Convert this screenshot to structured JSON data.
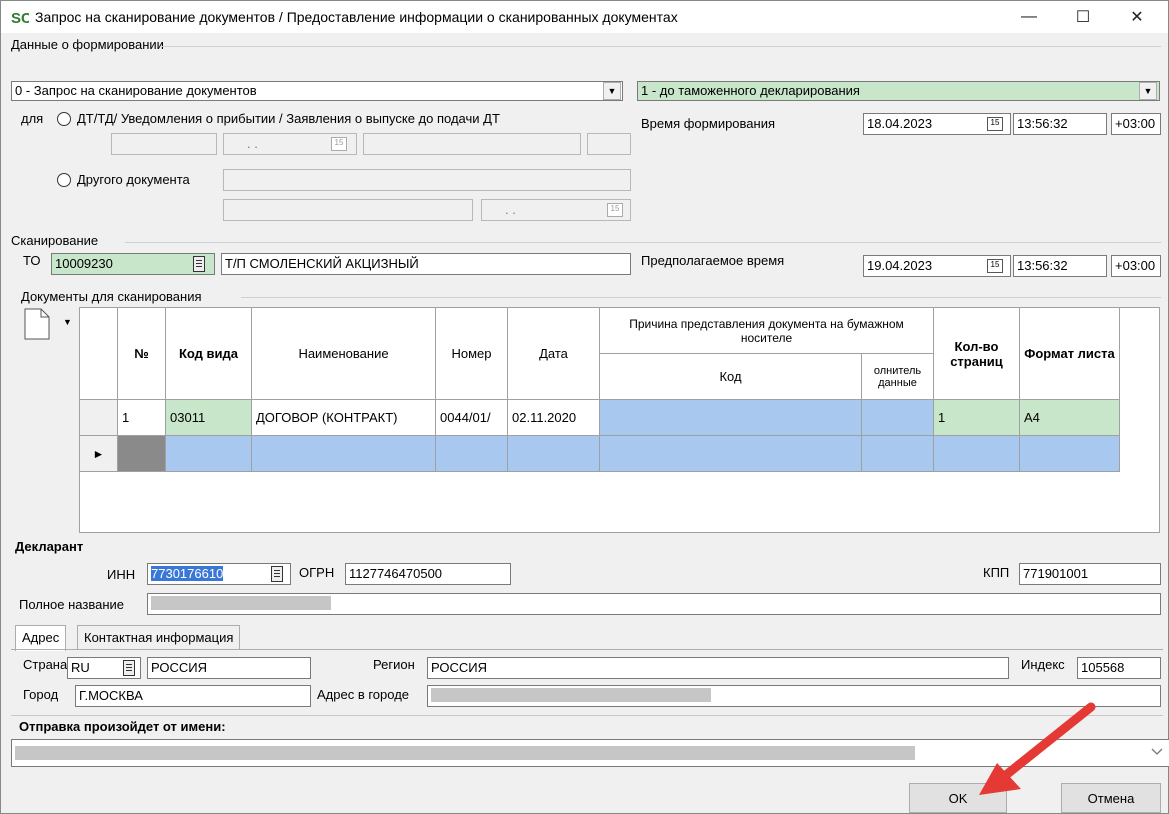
{
  "window": {
    "title": "Запрос на сканирование документов / Предоставление информации о сканированных документах",
    "minimize": "—",
    "maximize": "☐",
    "close": "✕"
  },
  "formation": {
    "section_label": "Данные о формировании",
    "request_type": "0 - Запрос на сканирование  документов",
    "stage": "1 - до таможенного декларирования",
    "for_label": "для",
    "radio_dt": "ДТ/ТД/ Уведомления о прибытии / Заявления о выпуске до подачи ДТ",
    "radio_other": "Другого документа",
    "date_placeholder": ". .",
    "time_label": "Время формирования",
    "date": "18.04.2023",
    "time": "13:56:32",
    "tz": "+03:00"
  },
  "scanning": {
    "section_label": "Сканирование",
    "to_label": "ТО",
    "to_code": "10009230",
    "to_name": "Т/П СМОЛЕНСКИЙ АКЦИЗНЫЙ",
    "expected_label": "Предполагаемое время",
    "date": "19.04.2023",
    "time": "13:56:32",
    "tz": "+03:00"
  },
  "documents": {
    "section_label": "Документы для сканирования",
    "headers": {
      "num": "№",
      "kind_code": "Код вида",
      "name": "Наименование",
      "number": "Номер",
      "date": "Дата",
      "reason": "Причина представления документа на бумажном носителе",
      "reason_code": "Код",
      "extra": "олнитель данные",
      "pages": "Кол-во страниц",
      "format": "Формат листа"
    },
    "rows": [
      {
        "num": "1",
        "kind_code": "03011",
        "name": "ДОГОВОР (КОНТРАКТ)",
        "number": "0044/01/",
        "date": "02.11.2020",
        "reason_code": "",
        "extra": "",
        "pages": "1",
        "format": "A4"
      }
    ],
    "new_row_marker": "►"
  },
  "declarant": {
    "section_label": "Декларант",
    "inn_label": "ИНН",
    "inn": "7730176610",
    "ogrn_label": "ОГРН",
    "ogrn": "1127746470500",
    "kpp_label": "КПП",
    "kpp": "771901001",
    "fullname_label": "Полное название",
    "tabs": [
      "Адрес",
      "Контактная информация"
    ],
    "country_label": "Страна",
    "country_code": "RU",
    "country_name": "РОССИЯ",
    "region_label": "Регион",
    "region": "РОССИЯ",
    "index_label": "Индекс",
    "index": "105568",
    "city_label": "Город",
    "city": "Г.МОСКВА",
    "address_label": "Адрес в городе"
  },
  "sender": {
    "label": "Отправка произойдет от имени:"
  },
  "buttons": {
    "ok": "OK",
    "cancel": "Отмена"
  },
  "colors": {
    "green_field": "#c8e6c9",
    "selected_blue": "#a8c8f0",
    "arrow_red": "#e53935"
  }
}
